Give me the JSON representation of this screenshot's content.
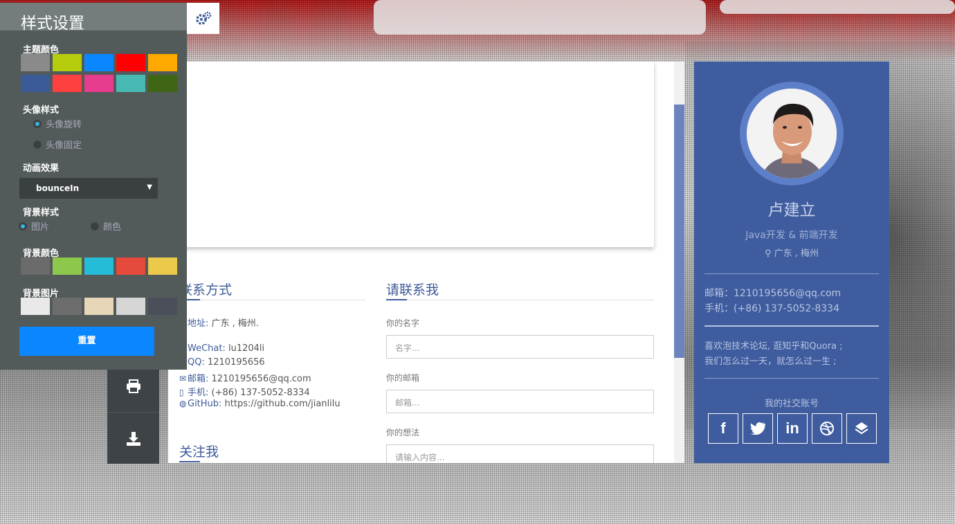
{
  "settings": {
    "title": "样式设置",
    "theme_color_label": "主题颜色",
    "theme_colors": [
      "#8a8a8a",
      "#b5cc0c",
      "#0a86ff",
      "#ff0000",
      "#ffa800",
      "#3d5a98",
      "#ff4040",
      "#e83d8f",
      "#48b8b3",
      "#3e6614"
    ],
    "avatar_style_label": "头像样式",
    "avatar_options": [
      "头像旋转",
      "头像固定"
    ],
    "animation_label": "动画效果",
    "animation_value": "bounceIn",
    "bg_style_label": "背景样式",
    "bg_style_options": [
      "图片",
      "颜色"
    ],
    "bg_color_label": "背景颜色",
    "bg_colors": [
      "#6b6b6b",
      "#8dc74c",
      "#24bcd6",
      "#e64a3c",
      "#ebc94a"
    ],
    "bg_image_label": "背景图片",
    "bg_images": [
      "#e9e9e9",
      "#6d6d6d",
      "#e8d6b8",
      "#d6d6d6",
      "#4a4f5a"
    ],
    "reset_label": "重置",
    "gear_icon": "gears-icon"
  },
  "iconbar": {
    "print_icon": "print-icon",
    "download_icon": "download-icon"
  },
  "contact": {
    "title": "联系方式",
    "address_label": "地址:",
    "address_value": " 广东 , 梅州.",
    "wechat_label": "WeChat:",
    "wechat_value": " lu1204li",
    "qq_label": "QQ:",
    "qq_value": " 1210195656",
    "email_label": "邮箱:",
    "email_value": " 1210195656@qq.com",
    "phone_label": "手机:",
    "phone_value": " (+86) 137-5052-8334",
    "github_label": "GitHub:",
    "github_value": " https://github.com/jianlilu"
  },
  "follow": {
    "title": "关注我"
  },
  "form": {
    "title": "请联系我",
    "name_label": "你的名字",
    "name_placeholder": "名字...",
    "email_label": "你的邮箱",
    "email_placeholder": "邮箱...",
    "thought_label": "你的想法",
    "thought_placeholder": "请输入内容..."
  },
  "profile": {
    "name": "卢建立",
    "role": "Java开发 & 前端开发",
    "location": "广东 , 梅州",
    "email": "邮箱：1210195656@qq.com",
    "phone": "手机：(+86) 137-5052-8334",
    "bio_line1": "喜欢泡技术论坛, 逛知乎和Quora ;",
    "bio_line2": "我们怎么过一天，就怎么过一生 ;",
    "social_title": "我的社交账号",
    "social": [
      "f",
      "t",
      "in",
      "dribbble",
      "stack"
    ]
  },
  "colors": {
    "accent": "#3d5a98",
    "panel_bg": "#525a5a",
    "reset_button": "#0a86ff"
  }
}
